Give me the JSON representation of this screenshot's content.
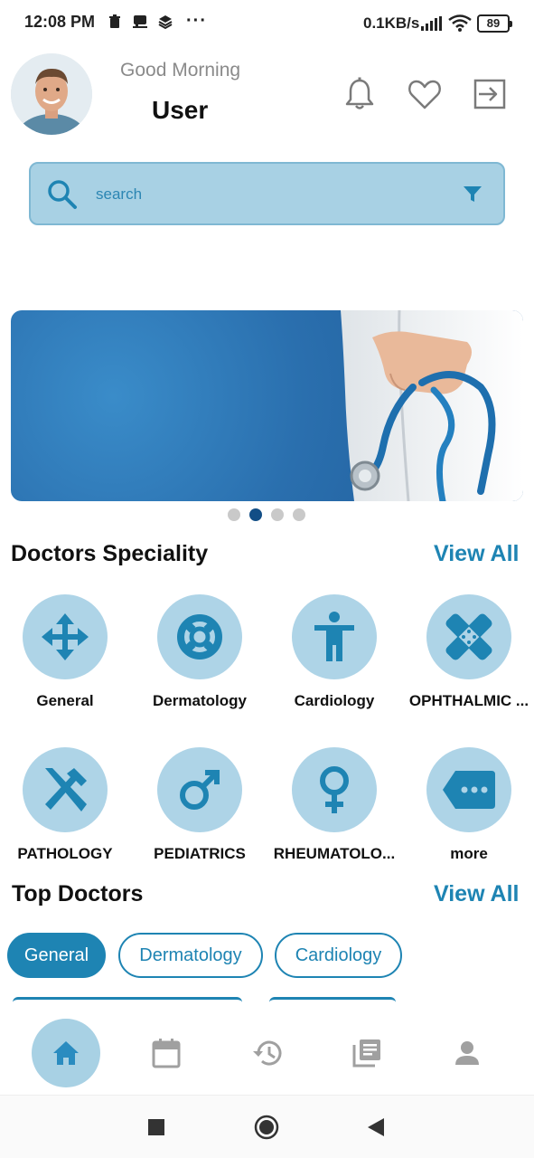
{
  "status_bar": {
    "time": "12:08 PM",
    "dots": "···",
    "speed": "0.1KB/s",
    "battery": "89"
  },
  "header": {
    "greeting": "Good Morning",
    "username": "User",
    "icons": [
      "bell-icon",
      "heart-icon",
      "logout-icon"
    ]
  },
  "search": {
    "placeholder": "search"
  },
  "banner": {
    "slides": 4,
    "active_slide": 2
  },
  "specialities": {
    "title": "Doctors Speciality",
    "view_all": "View All",
    "items": [
      {
        "label": "General",
        "icon": "move-arrows-icon"
      },
      {
        "label": "Dermatology",
        "icon": "lifebuoy-icon"
      },
      {
        "label": "Cardiology",
        "icon": "person-icon"
      },
      {
        "label": "OPHTHALMIC ...",
        "icon": "bandage-icon"
      },
      {
        "label": "PATHOLOGY",
        "icon": "tools-icon"
      },
      {
        "label": "PEDIATRICS",
        "icon": "male-icon"
      },
      {
        "label": "RHEUMATOLO...",
        "icon": "female-icon"
      },
      {
        "label": "more",
        "icon": "more-tag-icon"
      }
    ]
  },
  "top_doctors": {
    "title": "Top Doctors",
    "view_all": "View All",
    "filters": [
      "General",
      "Dermatology",
      "Cardiology"
    ],
    "active_filter": "General"
  },
  "bottom_nav": {
    "items": [
      "home-icon",
      "calendar-icon",
      "history-icon",
      "articles-icon",
      "profile-icon"
    ],
    "active": "home-icon"
  },
  "colors": {
    "accent": "#1e84b3",
    "light_accent": "#aed4e7",
    "banner_blue": "#2a6fae"
  }
}
